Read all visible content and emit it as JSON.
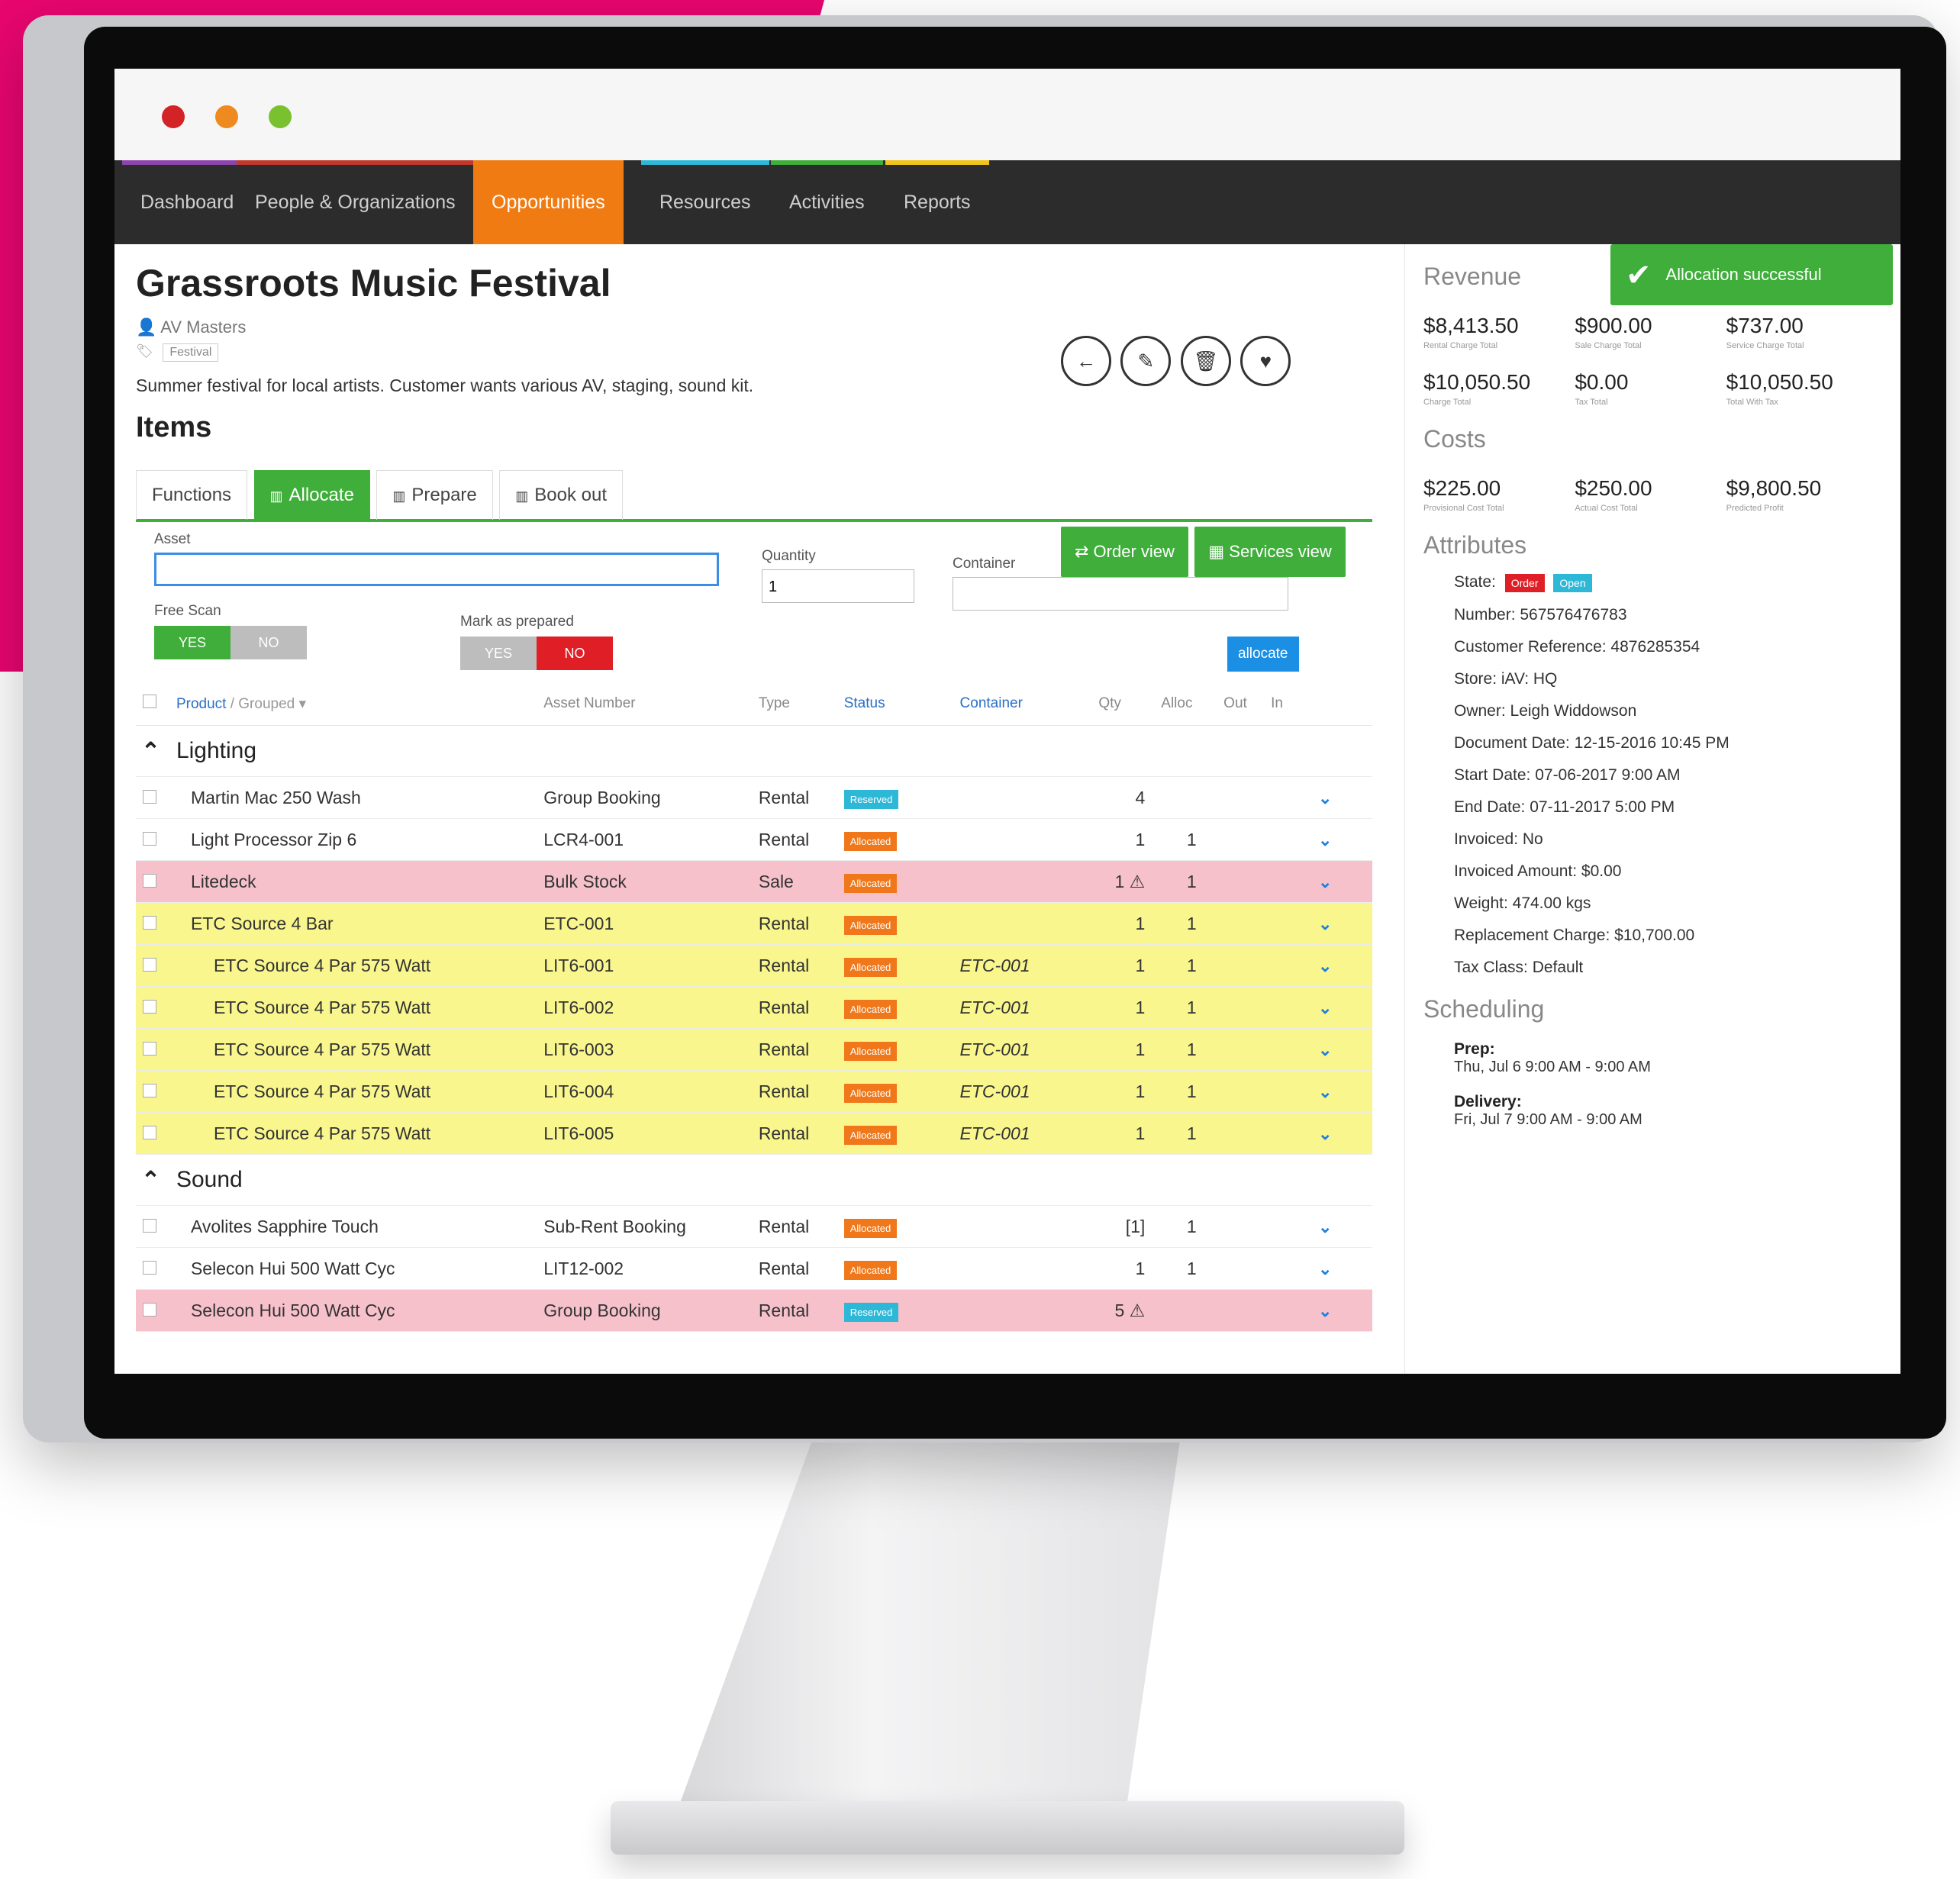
{
  "nav": {
    "items": [
      {
        "label": "Dashboard",
        "color": "#8e44ad",
        "active": false
      },
      {
        "label": "People & Organizations",
        "color": "#c0392b",
        "active": false
      },
      {
        "label": "Opportunities",
        "color": "#f07b12",
        "active": true
      },
      {
        "label": "Resources",
        "color": "#2db8d8",
        "active": false
      },
      {
        "label": "Activities",
        "color": "#3fae3a",
        "active": false
      },
      {
        "label": "Reports",
        "color": "#f0c419",
        "active": false
      }
    ]
  },
  "toast": {
    "text": "Allocation successful"
  },
  "opportunity": {
    "title": "Grassroots Music Festival",
    "organization": "AV Masters",
    "tag": "Festival",
    "description": "Summer festival for local artists. Customer wants various AV, staging, sound kit."
  },
  "items": {
    "heading": "Items",
    "tabs": [
      "Functions",
      "Allocate",
      "Prepare",
      "Book out"
    ],
    "active_tab": "Allocate",
    "order_view": "Order view",
    "services_view": "Services view",
    "form": {
      "asset_label": "Asset",
      "quantity_label": "Quantity",
      "quantity_value": "1",
      "container_label": "Container",
      "free_scan_label": "Free Scan",
      "mark_prepared_label": "Mark as prepared",
      "yes": "YES",
      "no": "NO",
      "allocate_button": "allocate"
    },
    "columns": {
      "product": "Product",
      "grouped": "Grouped",
      "asset_number": "Asset Number",
      "type": "Type",
      "status": "Status",
      "container": "Container",
      "qty": "Qty",
      "alloc": "Alloc",
      "out": "Out",
      "in": "In"
    },
    "groups": [
      {
        "name": "Lighting",
        "rows": [
          {
            "product": "Martin Mac 250 Wash",
            "asset": "Group Booking",
            "type": "Rental",
            "status": "Reserved",
            "container": "",
            "qty": "4",
            "alloc": "",
            "row": "normal",
            "indent": false
          },
          {
            "product": "Light Processor Zip 6",
            "asset": "LCR4-001",
            "type": "Rental",
            "status": "Allocated",
            "container": "",
            "qty": "1",
            "alloc": "1",
            "row": "normal",
            "indent": false
          },
          {
            "product": "Litedeck",
            "asset": "Bulk Stock",
            "type": "Sale",
            "status": "Allocated",
            "container": "",
            "qty": "1 ⚠",
            "alloc": "1",
            "row": "red",
            "indent": false
          },
          {
            "product": "ETC Source 4 Bar",
            "asset": "ETC-001",
            "type": "Rental",
            "status": "Allocated",
            "container": "",
            "qty": "1",
            "alloc": "1",
            "row": "yellow",
            "indent": false
          },
          {
            "product": "ETC Source 4 Par 575 Watt",
            "asset": "LIT6-001",
            "type": "Rental",
            "status": "Allocated",
            "container": "ETC-001",
            "qty": "1",
            "alloc": "1",
            "row": "yellow",
            "indent": true
          },
          {
            "product": "ETC Source 4 Par 575 Watt",
            "asset": "LIT6-002",
            "type": "Rental",
            "status": "Allocated",
            "container": "ETC-001",
            "qty": "1",
            "alloc": "1",
            "row": "yellow",
            "indent": true
          },
          {
            "product": "ETC Source 4 Par 575 Watt",
            "asset": "LIT6-003",
            "type": "Rental",
            "status": "Allocated",
            "container": "ETC-001",
            "qty": "1",
            "alloc": "1",
            "row": "yellow",
            "indent": true
          },
          {
            "product": "ETC Source 4 Par 575 Watt",
            "asset": "LIT6-004",
            "type": "Rental",
            "status": "Allocated",
            "container": "ETC-001",
            "qty": "1",
            "alloc": "1",
            "row": "yellow",
            "indent": true
          },
          {
            "product": "ETC Source 4 Par 575 Watt",
            "asset": "LIT6-005",
            "type": "Rental",
            "status": "Allocated",
            "container": "ETC-001",
            "qty": "1",
            "alloc": "1",
            "row": "yellow",
            "indent": true
          }
        ]
      },
      {
        "name": "Sound",
        "rows": [
          {
            "product": "Avolites Sapphire Touch",
            "asset": "Sub-Rent Booking",
            "type": "Rental",
            "status": "Allocated",
            "container": "",
            "qty": "[1]",
            "alloc": "1",
            "row": "normal",
            "indent": false
          },
          {
            "product": "Selecon Hui 500 Watt Cyc",
            "asset": "LIT12-002",
            "type": "Rental",
            "status": "Allocated",
            "container": "",
            "qty": "1",
            "alloc": "1",
            "row": "normal",
            "indent": false
          },
          {
            "product": "Selecon Hui 500 Watt Cyc",
            "asset": "Group Booking",
            "type": "Rental",
            "status": "Reserved",
            "container": "",
            "qty": "5 ⚠",
            "alloc": "",
            "row": "red",
            "indent": false
          }
        ]
      }
    ]
  },
  "revenue": {
    "title": "Revenue",
    "stats": [
      {
        "value": "$8,413.50",
        "label": "Rental Charge Total"
      },
      {
        "value": "$900.00",
        "label": "Sale Charge Total"
      },
      {
        "value": "$737.00",
        "label": "Service Charge Total"
      },
      {
        "value": "$10,050.50",
        "label": "Charge Total"
      },
      {
        "value": "$0.00",
        "label": "Tax Total"
      },
      {
        "value": "$10,050.50",
        "label": "Total With Tax"
      }
    ]
  },
  "costs": {
    "title": "Costs",
    "stats": [
      {
        "value": "$225.00",
        "label": "Provisional Cost Total"
      },
      {
        "value": "$250.00",
        "label": "Actual Cost Total"
      },
      {
        "value": "$9,800.50",
        "label": "Predicted Profit"
      }
    ]
  },
  "attributes": {
    "title": "Attributes",
    "state_label": "State:",
    "state_order": "Order",
    "state_open": "Open",
    "lines": [
      "Number: 567576476783",
      "Customer Reference: 4876285354",
      "Store: iAV: HQ",
      "Owner: Leigh Widdowson",
      "Document Date: 12-15-2016 10:45 PM",
      "Start Date: 07-06-2017 9:00 AM",
      "End Date: 07-11-2017 5:00 PM",
      "Invoiced: No",
      "Invoiced Amount: $0.00",
      "Weight: 474.00 kgs",
      "Replacement Charge: $10,700.00",
      "Tax Class: Default"
    ]
  },
  "scheduling": {
    "title": "Scheduling",
    "entries": [
      {
        "label": "Prep:",
        "value": "Thu, Jul 6 9:00 AM - 9:00 AM"
      },
      {
        "label": "Delivery:",
        "value": "Fri, Jul 7 9:00 AM - 9:00 AM"
      }
    ]
  }
}
